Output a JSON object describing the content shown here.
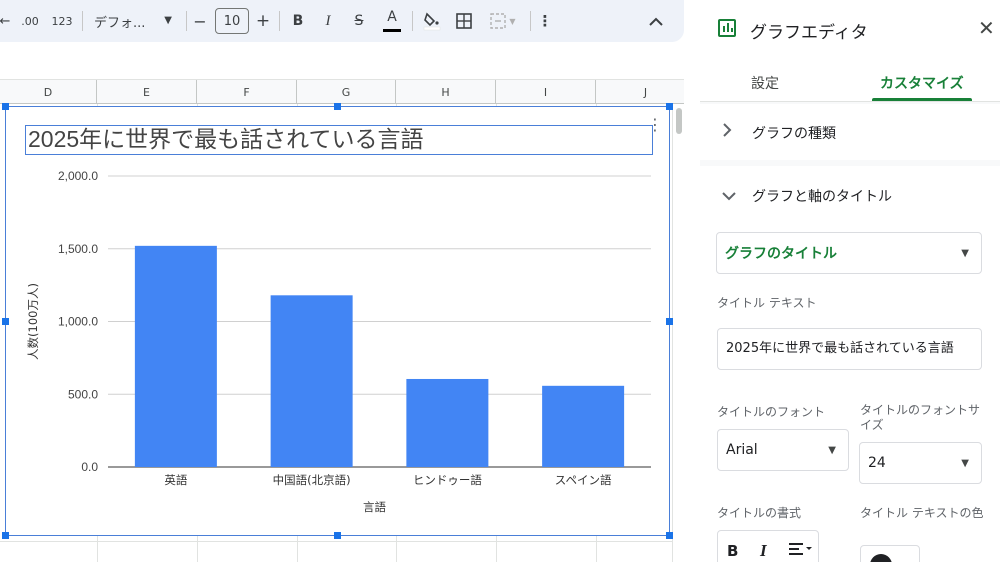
{
  "toolbar": {
    "decimal_increase": ".00",
    "number_format": "123",
    "font_name": "デフォ...",
    "minus": "−",
    "font_size": "10",
    "plus": "+",
    "bold": "B",
    "italic": "I",
    "strike": "S",
    "text_color": "A"
  },
  "sheet": {
    "columns": [
      "D",
      "E",
      "F",
      "G",
      "H",
      "I",
      "J"
    ]
  },
  "chart": {
    "title": "2025年に世界で最も話されている言語"
  },
  "chart_data": {
    "type": "bar",
    "title": "2025年に世界で最も話されている言語",
    "categories": [
      "英語",
      "中国語(北京語)",
      "ヒンドゥー語",
      "スペイン語"
    ],
    "series": [
      {
        "values": [
          1520,
          1180,
          605,
          558
        ],
        "color": "#4285f4"
      }
    ],
    "xlabel": "言語",
    "ylabel": "人数(100万人)",
    "ylim": [
      0,
      2000
    ],
    "yticks": [
      "0.0",
      "500.0",
      "1,000.0",
      "1,500.0",
      "2,000.0"
    ],
    "grid": true,
    "legend": "none"
  },
  "panel": {
    "title": "グラフエディタ",
    "tabs": {
      "settings": "設定",
      "customize": "カスタマイズ"
    },
    "sections": {
      "chart_type": "グラフの種類",
      "chart_axis_titles": "グラフと軸のタイトル"
    },
    "title_selector": "グラフのタイトル",
    "title_text_label": "タイトル テキスト",
    "title_text_value": "2025年に世界で最も話されている言語",
    "title_font_label": "タイトルのフォント",
    "title_font_value": "Arial",
    "title_font_size_label": "タイトルのフォントサイズ",
    "title_font_size_value": "24",
    "title_format_label": "タイトルの書式",
    "title_color_label": "タイトル テキストの色",
    "format_bold": "B",
    "format_italic": "I"
  },
  "colors": {
    "accent": "#188038",
    "bar": "#4285f4",
    "selection": "#1a73e8"
  }
}
